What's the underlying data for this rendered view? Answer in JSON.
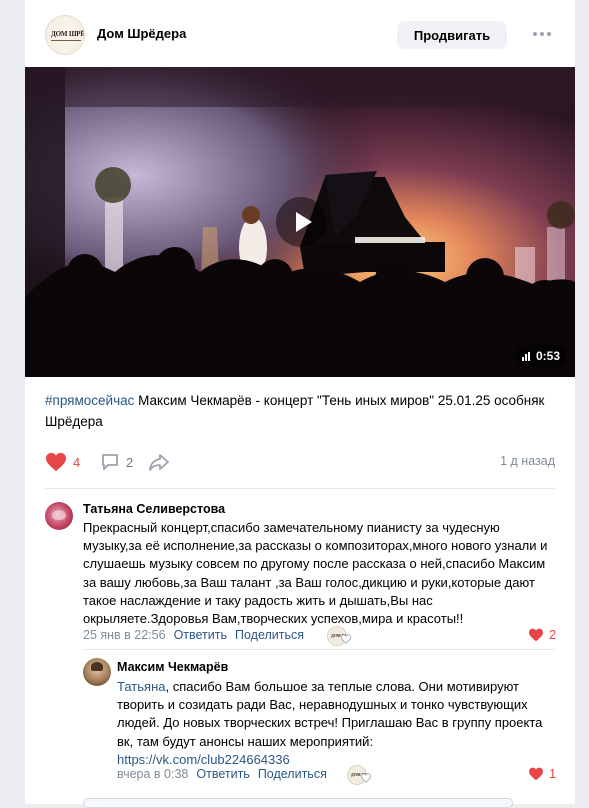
{
  "post": {
    "author": "Дом Шрёдера",
    "avatar_text": "ДОМ ШРЁДЕРА",
    "promote_label": "Продвигать",
    "video_duration": "0:53",
    "hashtag": "#прямосейчас",
    "text": " Максим Чекмарёв - концерт \"Тень иных миров\" 25.01.25 особняк Шрёдера",
    "likes": "4",
    "comments": "2",
    "time_ago": "1 д назад",
    "colors": {
      "like": "#e64646",
      "link": "#2a5885",
      "muted": "#818c99"
    }
  },
  "comments": [
    {
      "author": "Татьяна Селиверстова",
      "text": "Прекрасный концерт,спасибо замечательному пианисту за чудесную музыку,за её исполнение,за рассказы о композиторах,много нового узнали и слушаешь музыку совсем по другому после рассказа о ней,спасибо Максим за вашу любовь,за Ваш талант ,за Ваш голос,дикцию и руки,которые дают такое наслаждение и таку радость жить и дышать,Вы нас окрыляете.Здоровья Вам,творческих успехов,мира и красоты!!",
      "date": "25 янв в 22:56",
      "reply_label": "Ответить",
      "share_label": "Поделиться",
      "likes": "2"
    },
    {
      "author": "Максим Чекмарёв",
      "reply_to": "Татьяна",
      "text": ", спасибо Вам большое за теплые слова. Они мотивируют творить и созидать ради Вас, неравнодушных и тонко чувствующих людей. До новых творческих встреч! Приглашаю Вас в группу проекта вк, там будут анонсы наших мероприятий:",
      "url": "https://vk.com/club224664336",
      "date": "вчера в 0:38",
      "reply_label": "Ответить",
      "share_label": "Поделиться",
      "likes": "1"
    }
  ]
}
